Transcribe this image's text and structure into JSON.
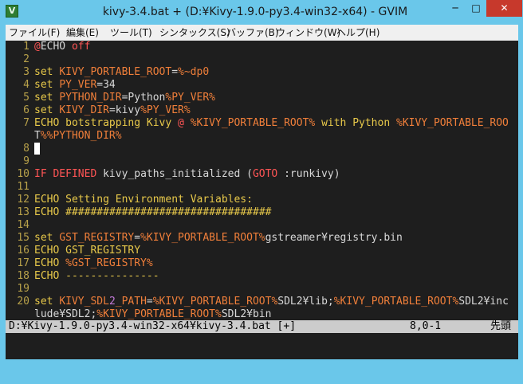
{
  "window": {
    "title": "kivy-3.4.bat + (D:¥Kivy-1.9.0-py3.4-win32-x64) - GVIM",
    "icon": "gvim-icon",
    "minimize_label": "─",
    "maximize_label": "□",
    "close_label": "✕"
  },
  "menu": [
    "ファイル(F)",
    "編集(E)",
    "ツール(T)",
    "シンタックス(S)",
    "バッファ(B)",
    "ウィンドウ(W)",
    "ヘルプ(H)"
  ],
  "editor": {
    "lines": [
      {
        "num": "1",
        "code": "@ECHO off"
      },
      {
        "num": "2",
        "code": ""
      },
      {
        "num": "3",
        "code": "set KIVY_PORTABLE_ROOT=%~dp0"
      },
      {
        "num": "4",
        "code": "set PY_VER=34"
      },
      {
        "num": "5",
        "code": "set PYTHON_DIR=Python%PY_VER%"
      },
      {
        "num": "6",
        "code": "set KIVY_DIR=kivy%PY_VER%"
      },
      {
        "num": "7",
        "code": "ECHO botstrapping Kivy @ %KIVY_PORTABLE_ROOT% with Python %KIVY_PORTABLE_ROO"
      },
      {
        "num": "",
        "code": "T%%PYTHON_DIR%"
      },
      {
        "num": "8",
        "code": ""
      },
      {
        "num": "9",
        "code": ""
      },
      {
        "num": "10",
        "code": "IF DEFINED kivy_paths_initialized (GOTO :runkivy)"
      },
      {
        "num": "11",
        "code": ""
      },
      {
        "num": "12",
        "code": "ECHO Setting Environment Variables:"
      },
      {
        "num": "13",
        "code": "ECHO #################################"
      },
      {
        "num": "14",
        "code": ""
      },
      {
        "num": "15",
        "code": "set GST_REGISTRY=%KIVY_PORTABLE_ROOT%gstreamer¥registry.bin"
      },
      {
        "num": "16",
        "code": "ECHO GST_REGISTRY"
      },
      {
        "num": "17",
        "code": "ECHO %GST_REGISTRY%"
      },
      {
        "num": "18",
        "code": "ECHO ---------------"
      },
      {
        "num": "19",
        "code": ""
      },
      {
        "num": "20",
        "code": "set KIVY_SDL2_PATH=%KIVY_PORTABLE_ROOT%SDL2¥lib;%KIVY_PORTABLE_ROOT%SDL2¥inc"
      },
      {
        "num": "",
        "code": "lude¥SDL2;%KIVY_PORTABLE_ROOT%SDL2¥bin"
      }
    ]
  },
  "statusbar": {
    "file": "D:¥Kivy-1.9.0-py3.4-win32-x64¥kivy-3.4.bat [+]",
    "position": "8,0-1",
    "scroll": "先頭"
  },
  "colors": {
    "editor_bg": "#1e1e1e",
    "line_number": "#b8a14a",
    "keyword": "#e8c94a",
    "variable": "#f07f3a",
    "number": "#c27ad8",
    "control": "#ff5555",
    "window_frame": "#6ac7ea"
  }
}
